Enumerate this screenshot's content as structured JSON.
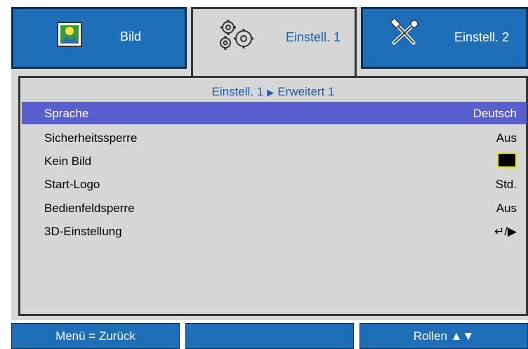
{
  "tabs": [
    {
      "label": "Bild",
      "icon": "picture-icon",
      "active": false
    },
    {
      "label": "Einstell. 1",
      "icon": "gears-icon",
      "active": true
    },
    {
      "label": "Einstell. 2",
      "icon": "tools-icon",
      "active": false
    }
  ],
  "breadcrumb": {
    "part1": "Einstell. 1",
    "separator": "▶",
    "part2": "Erweitert 1"
  },
  "rows": [
    {
      "label": "Sprache",
      "value": "Deutsch",
      "selected": true
    },
    {
      "label": "Sicherheitssperre",
      "value": "Aus"
    },
    {
      "label": "Kein Bild",
      "value": ""
    },
    {
      "label": "Start-Logo",
      "value": "Std."
    },
    {
      "label": "Bedienfeldsperre",
      "value": "Aus"
    },
    {
      "label": "3D-Einstellung",
      "value": "↵/▶"
    }
  ],
  "footer": {
    "back": "Menü = Zurück",
    "middle": "",
    "scroll": "Rollen ▲▼"
  },
  "colors": {
    "tab_blue": "#1e6fb8",
    "selected_row": "#5a5fd0",
    "panel_gray": "#d6d6d6",
    "highlight_yellow": "#f2e600"
  }
}
